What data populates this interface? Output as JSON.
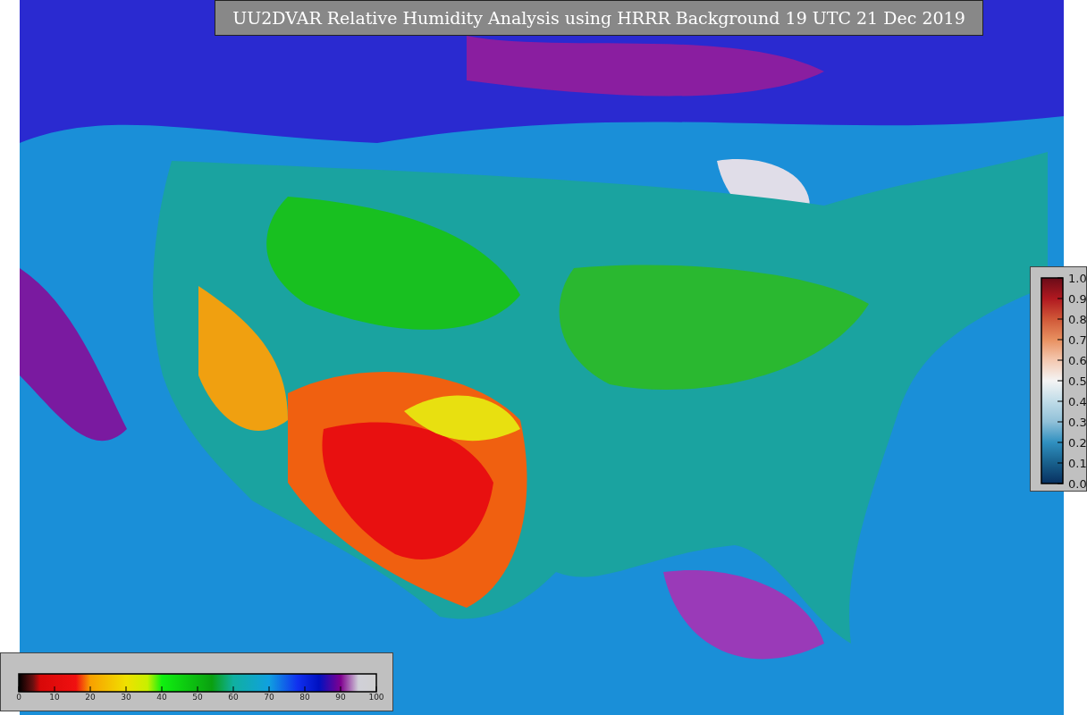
{
  "title": "UU2DVAR Relative Humidity Analysis using HRRR Background 19 UTC 21 Dec 2019",
  "humidity_scale": {
    "ticks": [
      "0",
      "10",
      "20",
      "30",
      "40",
      "50",
      "60",
      "70",
      "80",
      "90",
      "100"
    ]
  },
  "observation_scale": {
    "ticks": [
      "1.0",
      "0.9",
      "0.8",
      "0.7",
      "0.6",
      "0.5",
      "0.4",
      "0.3",
      "0.2",
      "0.1",
      "0.0"
    ]
  }
}
